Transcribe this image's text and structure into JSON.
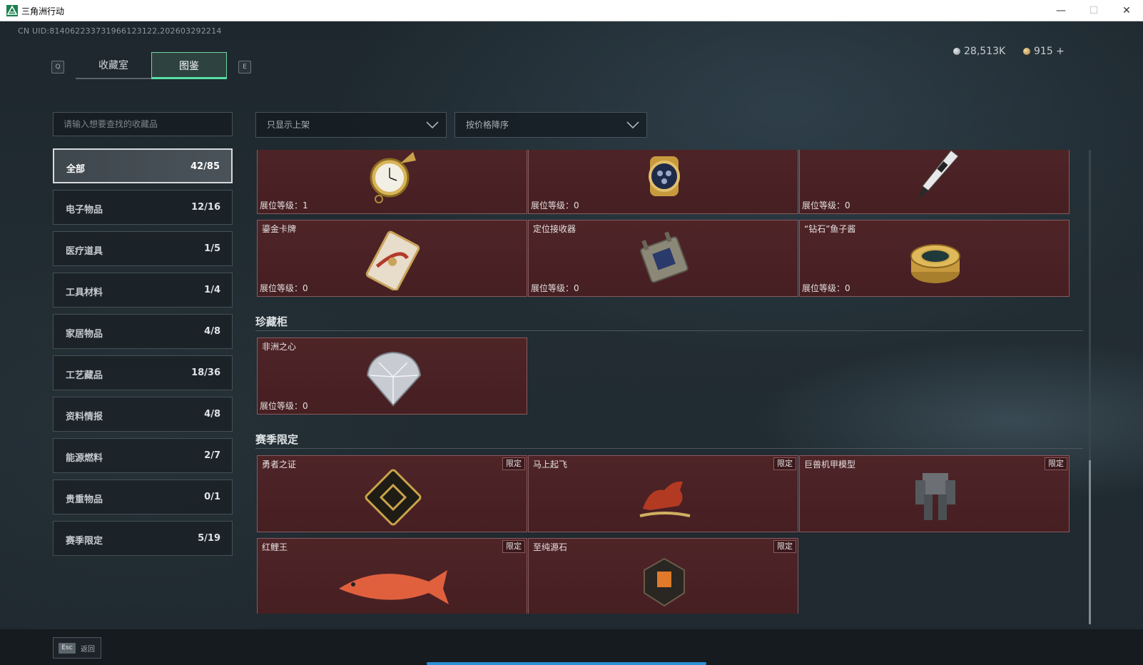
{
  "window": {
    "title": "三角洲行动",
    "minimize": "—",
    "maximize": "☐",
    "close": "✕"
  },
  "uid": "CN UID:814062233731966123122,202603292214",
  "tabs": {
    "left_key": "Q",
    "right_key": "E",
    "collection": "收藏室",
    "codex": "图鉴"
  },
  "currency": {
    "silver": "28,513K",
    "gold": "915 +"
  },
  "search": {
    "placeholder": "请输入想要查找的收藏品"
  },
  "categories": [
    {
      "label": "全部",
      "count": "42/85",
      "active": true
    },
    {
      "label": "电子物品",
      "count": "12/16"
    },
    {
      "label": "医疗道具",
      "count": "1/5"
    },
    {
      "label": "工具材料",
      "count": "1/4"
    },
    {
      "label": "家居物品",
      "count": "4/8"
    },
    {
      "label": "工艺藏品",
      "count": "18/36"
    },
    {
      "label": "资料情报",
      "count": "4/8"
    },
    {
      "label": "能源燃料",
      "count": "2/7"
    },
    {
      "label": "贵重物品",
      "count": "0/1"
    },
    {
      "label": "赛季限定",
      "count": "5/19"
    }
  ],
  "filters": {
    "shelf": "只显示上架",
    "sort": "按价格降序"
  },
  "level_prefix": "展位等级：",
  "top_cards": [
    {
      "name": "",
      "level": "1",
      "icon": "pocket-watch-icon"
    },
    {
      "name": "",
      "level": "0",
      "icon": "gold-wristwatch-icon"
    },
    {
      "name": "",
      "level": "0",
      "icon": "fountain-pen-icon"
    },
    {
      "name": "鎏金卡牌",
      "level": "0",
      "icon": "gilded-card-icon"
    },
    {
      "name": "定位接收器",
      "level": "0",
      "icon": "gps-receiver-icon"
    },
    {
      "name": "“钻石”鱼子酱",
      "level": "0",
      "icon": "caviar-tin-icon"
    }
  ],
  "sections": {
    "treasure": {
      "title": "珍藏柜",
      "cards": [
        {
          "name": "非洲之心",
          "level": "0",
          "icon": "diamond-icon"
        }
      ]
    },
    "season": {
      "title": "赛季限定",
      "badge": "限定",
      "cards": [
        {
          "name": "勇者之证",
          "icon": "brave-card-icon"
        },
        {
          "name": "马上起飞",
          "icon": "red-horse-statue-icon"
        },
        {
          "name": "巨兽机甲模型",
          "icon": "mech-model-icon"
        },
        {
          "name": "红鲤王",
          "icon": "red-carp-icon"
        },
        {
          "name": "至纯源石",
          "icon": "source-stone-icon"
        }
      ]
    }
  },
  "footer": {
    "esc_key": "Esc",
    "esc_label": "返回"
  },
  "colors": {
    "accent_green": "#58e0a3",
    "card_bg": "#4e2427",
    "progress_blue": "#2c8fd8"
  }
}
